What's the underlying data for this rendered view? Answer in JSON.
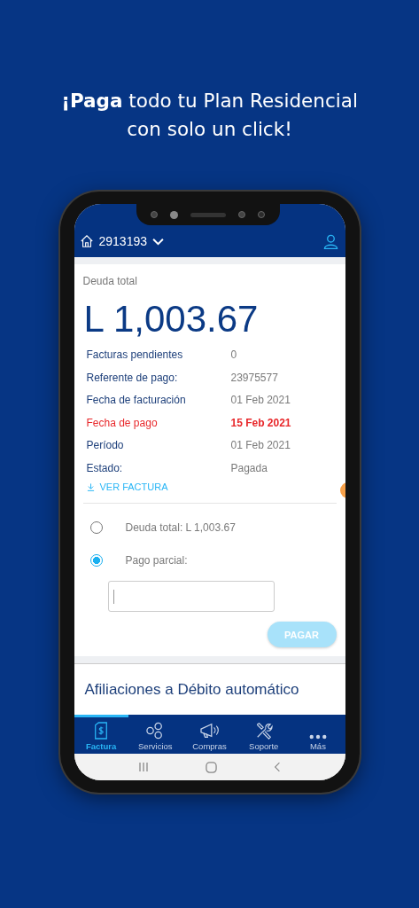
{
  "headline": "**¡Paga** todo tu Plan Residencial con solo un click!",
  "account": {
    "number": "2913193"
  },
  "debt": {
    "label": "Deuda total",
    "amount": "L 1,003.67"
  },
  "details": [
    {
      "label": "Facturas pendientes",
      "value": "0",
      "highlight": false
    },
    {
      "label": "Referente de pago:",
      "value": "23975577",
      "highlight": false
    },
    {
      "label": "Fecha de facturación",
      "value": "01 Feb 2021",
      "highlight": false
    },
    {
      "label": "Fecha de pago",
      "value": "15 Feb 2021",
      "highlight": true
    },
    {
      "label": "Período",
      "value": "01 Feb 2021",
      "highlight": false
    },
    {
      "label": "Estado:",
      "value": "Pagada",
      "highlight": false
    }
  ],
  "invoice_link": "VER FACTURA",
  "payment_options": [
    {
      "label": "Deuda total: L 1,003.67",
      "selected": false
    },
    {
      "label": "Pago parcial:",
      "selected": true
    }
  ],
  "pay_button": {
    "label": "PAGAR",
    "disabled": true
  },
  "section_title": "Afiliaciones a Débito automático",
  "nav": [
    {
      "label": "Factura",
      "kind": "invoice",
      "selected": true
    },
    {
      "label": "Servicios",
      "kind": "services",
      "selected": false
    },
    {
      "label": "Compras",
      "kind": "megaphone",
      "selected": false
    },
    {
      "label": "Soporte",
      "kind": "tools",
      "selected": false
    },
    {
      "label": "Más",
      "kind": "more",
      "selected": false
    }
  ]
}
